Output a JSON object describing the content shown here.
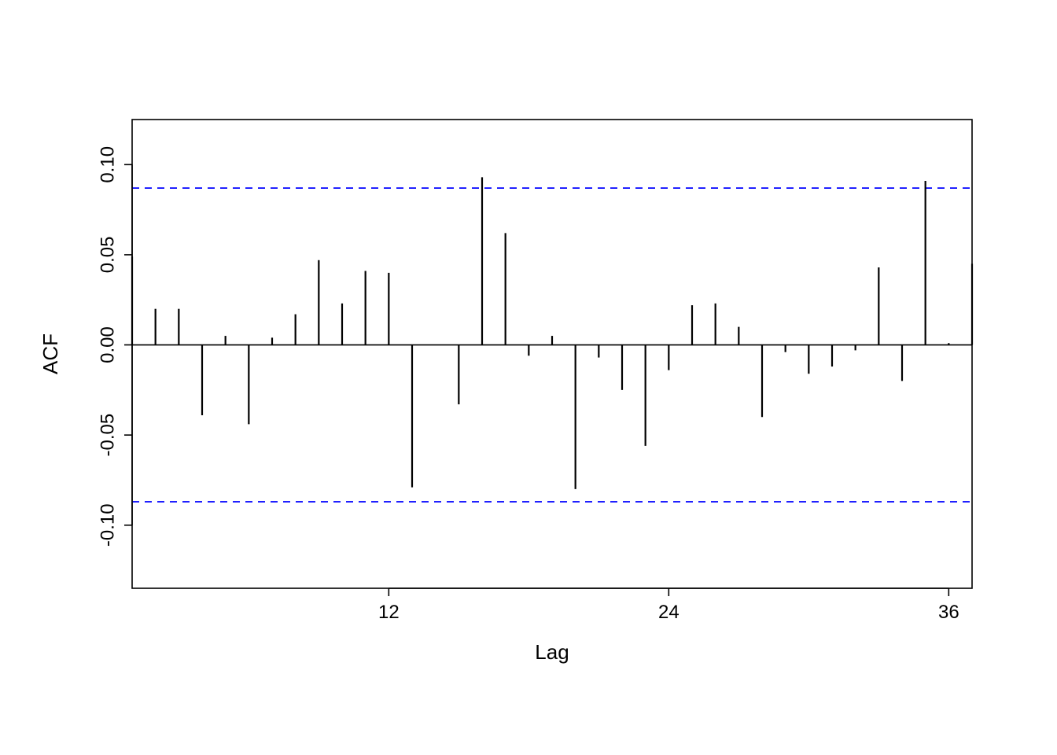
{
  "chart_data": {
    "type": "bar",
    "ylabel": "ACF",
    "xlabel": "Lag",
    "x_ticks": [
      12,
      24,
      36
    ],
    "y_ticks": [
      -0.1,
      -0.05,
      0.0,
      0.05,
      0.1
    ],
    "xlim": [
      1,
      37
    ],
    "ylim": [
      -0.135,
      0.125
    ],
    "confidence_bands": {
      "upper": 0.087,
      "lower": -0.087,
      "color": "#0000ff"
    },
    "lags": [
      1,
      2,
      3,
      4,
      5,
      6,
      7,
      8,
      9,
      10,
      11,
      12,
      13,
      14,
      15,
      16,
      17,
      18,
      19,
      20,
      21,
      22,
      23,
      24,
      25,
      26,
      27,
      28,
      29,
      30,
      31,
      32,
      33,
      34,
      35,
      36,
      37
    ],
    "values": [
      0.049,
      0.02,
      0.02,
      -0.039,
      0.005,
      -0.044,
      0.004,
      0.017,
      0.047,
      0.023,
      0.041,
      0.04,
      -0.079,
      0.0,
      -0.033,
      0.093,
      0.062,
      -0.006,
      0.005,
      -0.08,
      -0.007,
      -0.025,
      -0.056,
      -0.014,
      0.022,
      0.023,
      0.01,
      -0.04,
      -0.004,
      -0.016,
      -0.012,
      -0.003,
      0.043,
      -0.02,
      0.091,
      0.001,
      0.045
    ]
  }
}
